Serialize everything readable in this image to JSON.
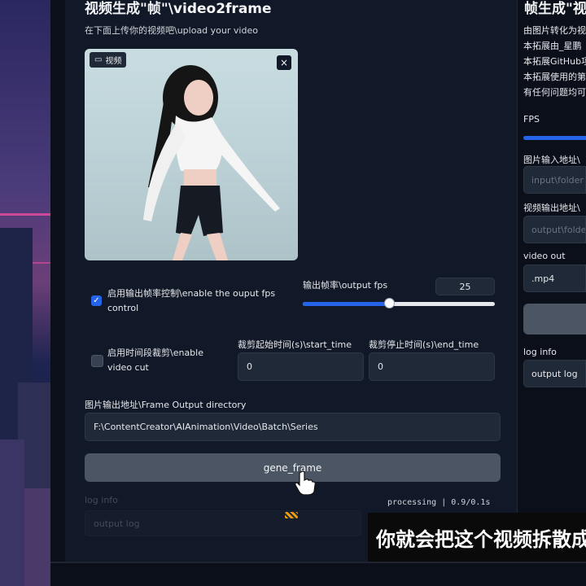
{
  "left_panel": {
    "title": "视频生成\"帧\"\\video2frame",
    "subtitle": "在下面上传你的视频吧\\upload your video",
    "video_tag_label": "视频",
    "video_close": "×",
    "fps_toggle": {
      "checked": true,
      "label_line1": "启用输出帧率控制\\enable the ouput fps",
      "label_line2": "control"
    },
    "output_fps": {
      "label": "输出帧率\\output fps",
      "value": "25",
      "slider_fraction": 0.45
    },
    "cut_toggle": {
      "checked": false,
      "label_line1": "启用时间段裁剪\\enable",
      "label_line2": "video cut"
    },
    "start_time": {
      "label": "裁剪起始时间(s)\\start_time",
      "value": "0"
    },
    "end_time": {
      "label": "裁剪停止时间(s)\\end_time",
      "value": "0"
    },
    "output_dir": {
      "label": "图片输出地址\\Frame Output directory",
      "value": "F:\\ContentCreator\\AIAnimation\\Video\\Batch\\Series"
    },
    "gene_button": "gene_frame",
    "log_info_label": "log info",
    "log_placeholder": "output log",
    "status": "processing | 0.9/0.1s"
  },
  "right_panel": {
    "title": "帧生成\"视",
    "lines": [
      "由图片转化为视",
      "本拓展由_星鹏",
      "本拓展GitHub项",
      "本拓展使用的第",
      "有任何问题均可"
    ],
    "fps_label": "FPS",
    "image_input_label": "图片输入地址\\",
    "image_input_placeholder": "input\\folder",
    "video_output_label": "视频输出地址\\",
    "video_output_placeholder": "output\\folder",
    "video_out_label": "video out",
    "video_out_value": ".mp4",
    "log_info_label": "log info",
    "log_value": "output log"
  },
  "caption": "你就会把这个视频拆散成",
  "colors": {
    "accent": "#2563eb",
    "panel": "#111827",
    "input": "#1f2937",
    "button": "#4b5563"
  }
}
